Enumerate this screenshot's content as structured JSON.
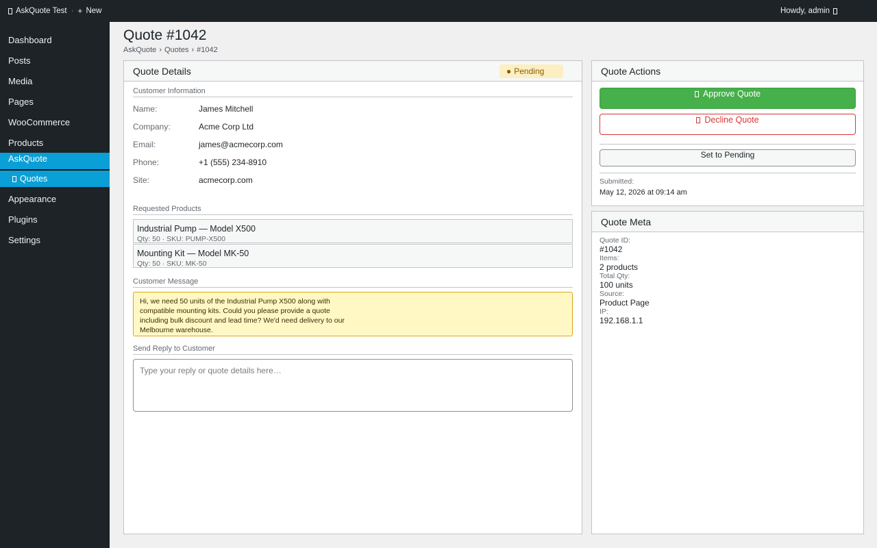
{
  "adminbar": {
    "site_name": "AskQuote Test",
    "separator": "·",
    "new_label": "New",
    "greeting": "Howdy, admin"
  },
  "sidebar": {
    "items": [
      {
        "label": "Dashboard"
      },
      {
        "label": "Posts"
      },
      {
        "label": "Media"
      },
      {
        "label": "Pages"
      },
      {
        "label": "WooCommerce"
      },
      {
        "label": "Products"
      },
      {
        "label": "AskQuote"
      },
      {
        "label": "Appearance"
      },
      {
        "label": "Plugins"
      },
      {
        "label": "Settings"
      }
    ],
    "submenu": {
      "label": "Quotes"
    }
  },
  "page": {
    "title": "Quote #1042",
    "breadcrumb": [
      "AskQuote",
      "›",
      "Quotes",
      "›",
      "#1042"
    ]
  },
  "details": {
    "title": "Quote Details",
    "status_dot": "●",
    "status": "Pending",
    "customer_section": "Customer Information",
    "customer": [
      {
        "key": "Name:",
        "value": "James Mitchell"
      },
      {
        "key": "Company:",
        "value": "Acme Corp Ltd"
      },
      {
        "key": "Email:",
        "value": "james@acmecorp.com"
      },
      {
        "key": "Phone:",
        "value": "+1 (555) 234-8910"
      },
      {
        "key": "Site:",
        "value": "acmecorp.com"
      }
    ],
    "products_section": "Requested Products",
    "products": [
      {
        "name": "Industrial Pump — Model X500",
        "meta": "Qty: 50   ·   SKU: PUMP-X500"
      },
      {
        "name": "Mounting Kit — Model MK-50",
        "meta": "Qty: 50   ·   SKU: MK-50"
      }
    ],
    "message_section": "Customer Message",
    "message": "Hi, we need 50 units of the Industrial Pump X500 along with compatible mounting kits. Could you please provide a quote including bulk discount and lead time? We'd need delivery to our Melbourne warehouse.",
    "reply_section": "Send Reply to Customer",
    "reply_placeholder": "Type your reply or quote details here…"
  },
  "actions": {
    "title": "Quote Actions",
    "approve_label": "Approve Quote",
    "decline_label": "Decline Quote",
    "pending_label": "Set to Pending",
    "submitted_label": "Submitted:",
    "submitted_value": "May 12, 2026 at 09:14 am"
  },
  "meta": {
    "title": "Quote Meta",
    "rows": [
      {
        "label": "Quote ID:",
        "value": "#1042"
      },
      {
        "label": "Items:",
        "value": "2 products"
      },
      {
        "label": "Total Qty:",
        "value": "100 units"
      },
      {
        "label": "Source:",
        "value": "Product Page"
      },
      {
        "label": "IP:",
        "value": "192.168.1.1"
      }
    ]
  },
  "colors": {
    "sidebar_bg": "#1d2327",
    "accent": "#0a9fd6",
    "approve": "#46b04a",
    "decline": "#d63638",
    "pending_badge_bg": "#fcf0c3",
    "message_bg": "#fff8c5"
  }
}
